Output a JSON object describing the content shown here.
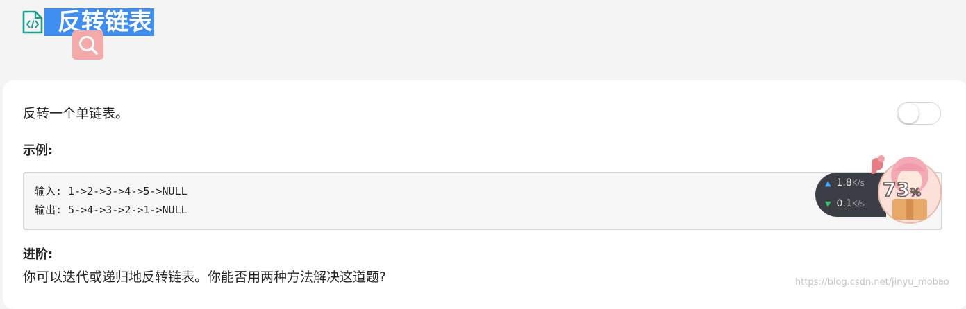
{
  "page": {
    "title": "反转链表",
    "intro": "反转一个单链表。",
    "example_heading": "示例:",
    "code_lines": [
      "输入: 1->2->3->4->5->NULL",
      "输出: 5->4->3->2->1->NULL"
    ],
    "advanced_heading": "进阶:",
    "advanced_text": "你可以迭代或递归地反转链表。你能否用两种方法解决这道题?",
    "watermark": "https://blog.csdn.net/jinyu_mobao"
  },
  "toggle": {
    "on": false
  },
  "net_widget": {
    "upload_speed": "1.8",
    "upload_unit": "K/s",
    "download_speed": "0.1",
    "download_unit": "K/s",
    "memory_percent": "73",
    "percent_symbol": "%"
  },
  "icons": {
    "title_icon": "code-file-icon",
    "search": "search-icon"
  },
  "colors": {
    "title_highlight": "#3d8ef0",
    "search_button": "#f3aaa9",
    "page_background": "#f4f4f4",
    "card_background": "#ffffff",
    "upload_arrow": "#4aa8ff",
    "download_arrow": "#3cc06a"
  }
}
